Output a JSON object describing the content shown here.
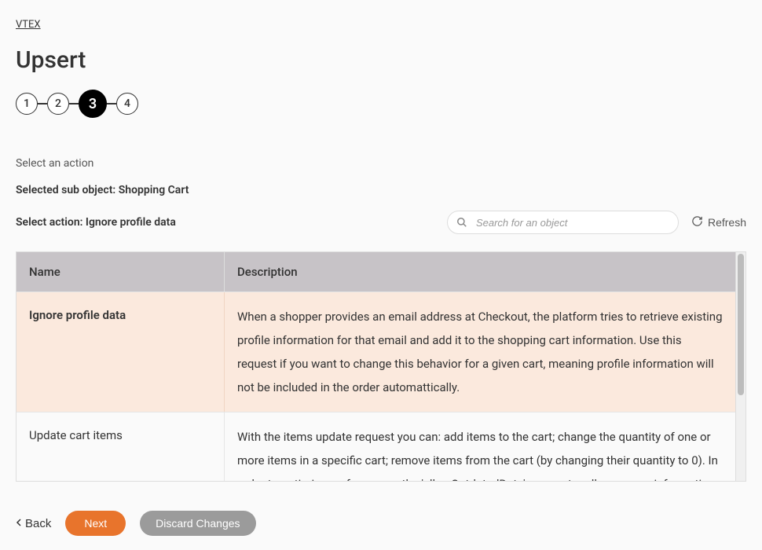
{
  "breadcrumb": "VTEX",
  "page_title": "Upsert",
  "stepper": {
    "steps": [
      "1",
      "2",
      "3",
      "4"
    ],
    "active_index": 2
  },
  "section_label": "Select an action",
  "selected_sub_object_label": "Selected sub object: Shopping Cart",
  "select_action_label": "Select action: Ignore profile data",
  "search": {
    "placeholder": "Search for an object"
  },
  "refresh_label": "Refresh",
  "table": {
    "headers": {
      "name": "Name",
      "description": "Description"
    },
    "rows": [
      {
        "name": "Ignore profile data",
        "description": "When a shopper provides an email address at Checkout, the platform tries to retrieve existing profile information for that email and add it to the shopping cart information. Use this request if you want to change this behavior for a given cart, meaning profile information will not be included in the order automattically.",
        "selected": true
      },
      {
        "name": "Update cart items",
        "description": "With the items update request you can: add items to the cart; change the quantity of one or more items in a specific cart; remove items from the cart (by changing their quantity to 0). In order to optimize performance, the 'allowOutdatedData' parameter allows some information to",
        "selected": false
      }
    ]
  },
  "footer": {
    "back": "Back",
    "next": "Next",
    "discard": "Discard Changes"
  }
}
